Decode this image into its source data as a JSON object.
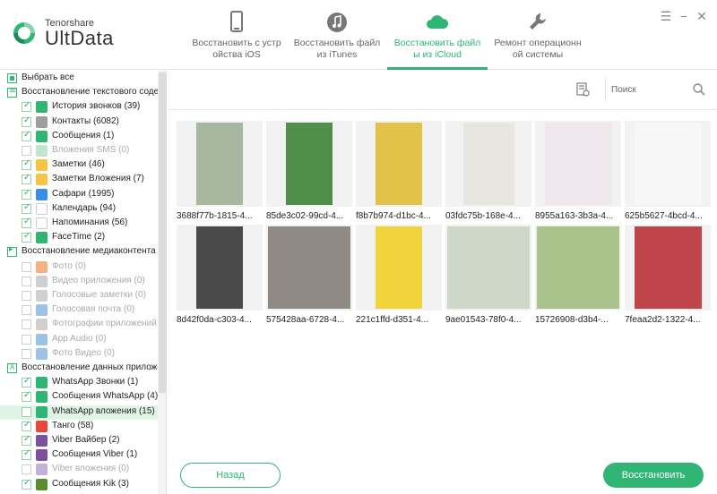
{
  "app": {
    "brand_small": "Tenorshare",
    "brand_big": "UltData",
    "accent": "#2fb574"
  },
  "nav": [
    {
      "label": "Восстановить с устр ойства iOS",
      "icon": "phone-icon",
      "active": false
    },
    {
      "label": "Восстановить файл из iTunes",
      "icon": "music-note-icon",
      "active": false
    },
    {
      "label": "Восстановить файл ы из iCloud",
      "icon": "cloud-icon",
      "active": true
    },
    {
      "label": "Ремонт операционн ой системы",
      "icon": "wrench-icon",
      "active": false
    }
  ],
  "window_controls": {
    "menu": "☰",
    "minimize": "−",
    "close": "✕"
  },
  "sidebar": {
    "select_all": "Выбрать все",
    "sections": [
      {
        "title": "Восстановление текстового содержимого",
        "items": [
          {
            "label": "История звонков (39)",
            "checked": true,
            "icon_color": "#2fb574",
            "enabled": true
          },
          {
            "label": "Контакты (6082)",
            "checked": true,
            "icon_color": "#9e9e9e",
            "enabled": true
          },
          {
            "label": "Сообщения (1)",
            "checked": true,
            "icon_color": "#2fb574",
            "enabled": true
          },
          {
            "label": "Вложения SMS (0)",
            "checked": false,
            "icon_color": "#bfe6cf",
            "enabled": false
          },
          {
            "label": "Заметки (46)",
            "checked": true,
            "icon_color": "#f5c542",
            "enabled": true
          },
          {
            "label": "Заметки Вложения (7)",
            "checked": true,
            "icon_color": "#f5c542",
            "enabled": true
          },
          {
            "label": "Сафари (1995)",
            "checked": true,
            "icon_color": "#3a8ee6",
            "enabled": true
          },
          {
            "label": "Календарь (94)",
            "checked": true,
            "icon_color": "#ffffff",
            "enabled": true
          },
          {
            "label": "Напоминания (56)",
            "checked": true,
            "icon_color": "#ffffff",
            "enabled": true
          },
          {
            "label": "FaceTime (2)",
            "checked": true,
            "icon_color": "#2fb574",
            "enabled": true
          }
        ]
      },
      {
        "title": "Восстановление медиаконтента",
        "items": [
          {
            "label": "Фото (0)",
            "checked": false,
            "icon_color": "#f4b183",
            "enabled": false
          },
          {
            "label": "Видео приложения (0)",
            "checked": false,
            "icon_color": "#cfcfcf",
            "enabled": false
          },
          {
            "label": "Голосовые заметки (0)",
            "checked": false,
            "icon_color": "#cfcfcf",
            "enabled": false
          },
          {
            "label": "Голосовая почта (0)",
            "checked": false,
            "icon_color": "#9cc2e5",
            "enabled": false
          },
          {
            "label": "Фотографии приложений (0)",
            "checked": false,
            "icon_color": "#cfcfcf",
            "enabled": false
          },
          {
            "label": "App Audio (0)",
            "checked": false,
            "icon_color": "#9cc2e5",
            "enabled": false
          },
          {
            "label": "Фото Видео (0)",
            "checked": false,
            "icon_color": "#9cc2e5",
            "enabled": false
          }
        ]
      },
      {
        "title": "Восстановление данных приложений",
        "items": [
          {
            "label": "WhatsApp Звонки (1)",
            "checked": true,
            "icon_color": "#2fb574",
            "enabled": true
          },
          {
            "label": "Сообщения WhatsApp (4)",
            "checked": true,
            "icon_color": "#2fb574",
            "enabled": true
          },
          {
            "label": "WhatsApp вложения (15)",
            "checked": false,
            "icon_color": "#2fb574",
            "enabled": true,
            "highlight": true
          },
          {
            "label": "Танго (58)",
            "checked": true,
            "icon_color": "#e8453c",
            "enabled": true
          },
          {
            "label": "Viber Вайбер (2)",
            "checked": true,
            "icon_color": "#7b519d",
            "enabled": true
          },
          {
            "label": "Сообщения Viber (1)",
            "checked": true,
            "icon_color": "#7b519d",
            "enabled": true
          },
          {
            "label": "Viber вложения (0)",
            "checked": false,
            "icon_color": "#c2b0d6",
            "enabled": false
          },
          {
            "label": "Сообщения Kik (3)",
            "checked": true,
            "icon_color": "#5c8a2e",
            "enabled": true
          }
        ]
      }
    ]
  },
  "toolbar": {
    "search_placeholder": "Поиск",
    "settings_icon": "file-settings-icon",
    "search_icon": "search-icon"
  },
  "photos": [
    {
      "name": "3688f77b-1815-4...",
      "color": "#a8b8a0",
      "aspect": 0.56
    },
    {
      "name": "85de3c02-99cd-4...",
      "color": "#4f8f4a",
      "aspect": 0.56
    },
    {
      "name": "f8b7b974-d1bc-4...",
      "color": "#e3c24a",
      "aspect": 0.56
    },
    {
      "name": "03fdc75b-168e-4...",
      "color": "#e8e6e1",
      "aspect": 0.62
    },
    {
      "name": "8955a163-3b3a-4...",
      "color": "#efe8ec",
      "aspect": 0.82
    },
    {
      "name": "625b5627-4bcd-4...",
      "color": "#f7f7f7",
      "aspect": 0.82
    },
    {
      "name": "8d42f0da-c303-4...",
      "color": "#4a4a4a",
      "aspect": 0.56
    },
    {
      "name": "575428aa-6728-4...",
      "color": "#8f8a84",
      "aspect": 1.0
    },
    {
      "name": "221c1ffd-d351-4...",
      "color": "#f1d43a",
      "aspect": 0.56
    },
    {
      "name": "9ae01543-78f0-4...",
      "color": "#cdd8c8",
      "aspect": 1.0
    },
    {
      "name": "15726908-d3b4-...",
      "color": "#a9c38a",
      "aspect": 1.0
    },
    {
      "name": "7feaa2d2-1322-4...",
      "color": "#c0454a",
      "aspect": 0.82
    }
  ],
  "footer": {
    "back_label": "Назад",
    "restore_label": "Восстановить"
  }
}
